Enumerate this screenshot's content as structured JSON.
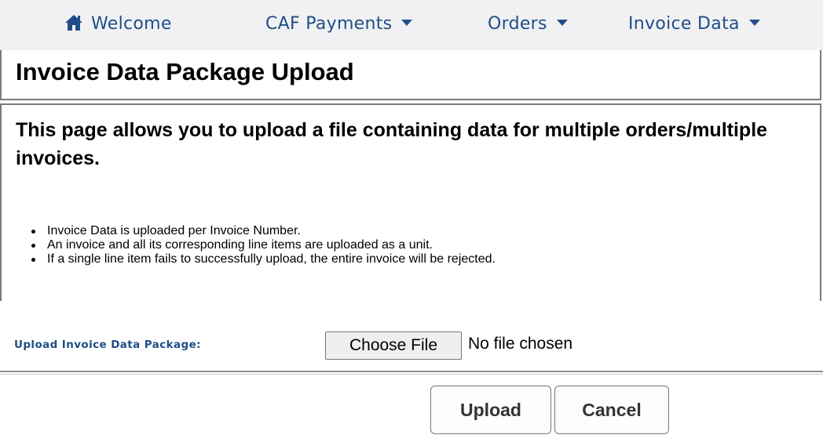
{
  "nav": {
    "items": [
      {
        "label": "Welcome",
        "icon": "home-icon"
      },
      {
        "label": "CAF Payments",
        "icon": "caret-down-icon"
      },
      {
        "label": "Orders",
        "icon": "caret-down-icon"
      },
      {
        "label": "Invoice Data",
        "icon": "caret-down-icon"
      }
    ]
  },
  "page": {
    "title": "Invoice Data Package Upload",
    "intro": "This page allows you to upload a file containing data for multiple orders/multiple invoices.",
    "bullets": [
      "Invoice Data is uploaded per Invoice Number.",
      "An invoice and all its corresponding line items are uploaded as a unit.",
      "If a single line item fails to successfully upload, the entire invoice will be rejected."
    ]
  },
  "upload": {
    "label": "Upload Invoice Data Package:",
    "choose_label": "Choose File",
    "no_file_text": "No file chosen"
  },
  "actions": {
    "upload_label": "Upload",
    "cancel_label": "Cancel"
  },
  "colors": {
    "nav_text": "#1f4e87",
    "nav_bg": "#f1f1f3",
    "border": "#7a7a7a"
  }
}
